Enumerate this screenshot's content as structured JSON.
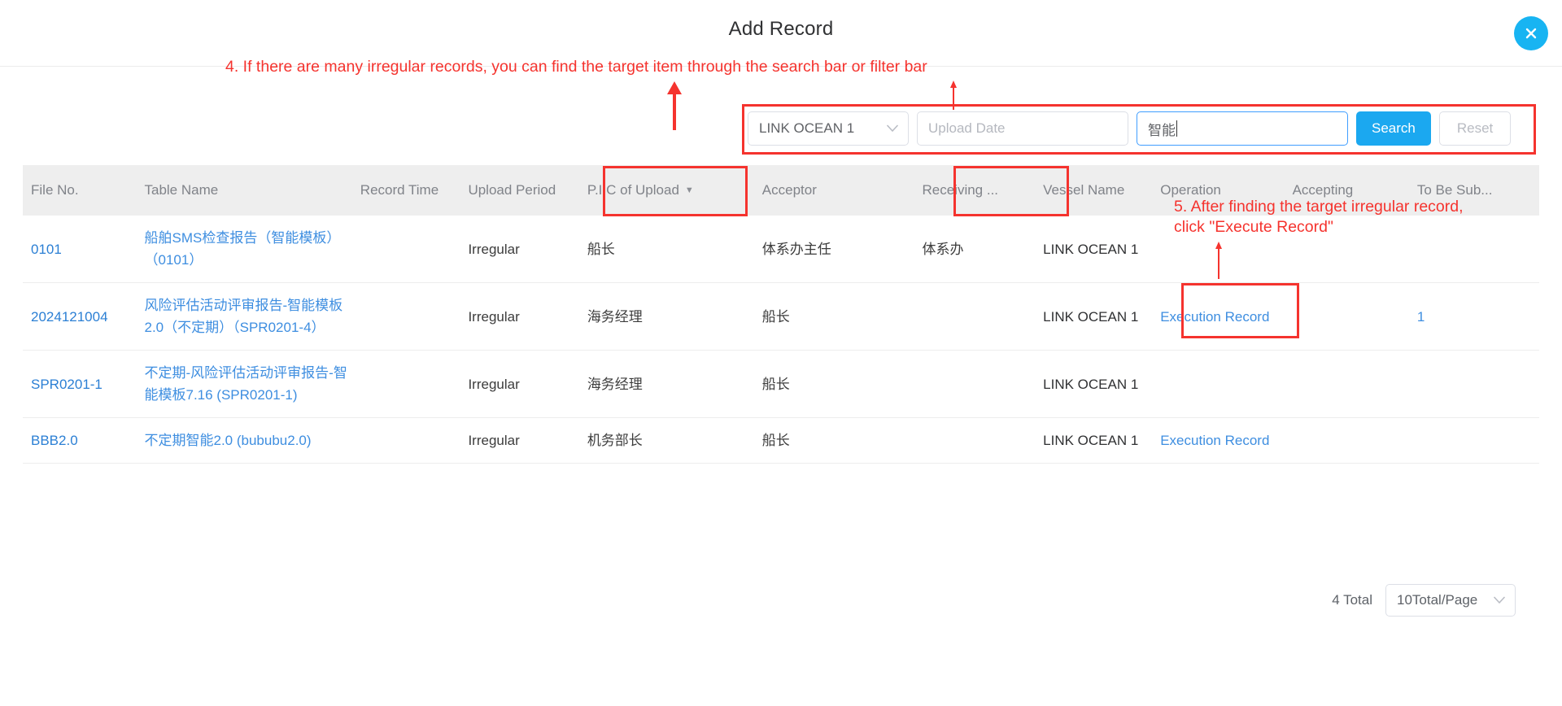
{
  "modal": {
    "title": "Add Record",
    "close_icon": "close-circle-icon"
  },
  "annotations": [
    {
      "id": "step4",
      "text": "4. If there are many irregular records, you can find the target item through the search bar or filter bar",
      "color": "#f5332e"
    },
    {
      "id": "step5",
      "line1": "5. After finding the target irregular record,",
      "line2": "click \"Execute Record\"",
      "color": "#f5332e"
    }
  ],
  "filter_bar": {
    "vessel_select": {
      "value": "LINK OCEAN 1",
      "caret_icon": "chevron-down-icon"
    },
    "upload_date": {
      "value": "",
      "placeholder": "Upload Date"
    },
    "keyword": {
      "value": "智能",
      "placeholder": ""
    },
    "search_label": "Search",
    "reset_label": "Reset"
  },
  "table": {
    "columns": [
      {
        "key": "file_no",
        "label": "File No."
      },
      {
        "key": "table_name",
        "label": "Table Name"
      },
      {
        "key": "record_time",
        "label": "Record Time"
      },
      {
        "key": "upload_period",
        "label": "Upload Period"
      },
      {
        "key": "pic_of_upload",
        "label": "P.I.C of Upload",
        "sortable": true,
        "sort_icon": "caret-down-icon"
      },
      {
        "key": "acceptor",
        "label": "Acceptor"
      },
      {
        "key": "receiving",
        "label": "Receiving ..."
      },
      {
        "key": "vessel_name",
        "label": "Vessel Name"
      },
      {
        "key": "operation",
        "label": "Operation"
      },
      {
        "key": "accepting",
        "label": "Accepting"
      },
      {
        "key": "to_be_sub",
        "label": "To Be Sub..."
      }
    ],
    "rows": [
      {
        "file_no": "0101",
        "table_name": "船舶SMS检查报告（智能模板）（0101）",
        "record_time": "",
        "upload_period": "Irregular",
        "pic_of_upload": "船长",
        "acceptor": "体系办主任",
        "receiving": "体系办",
        "vessel_name": "LINK OCEAN 1",
        "operation": "",
        "accepting": "",
        "to_be_sub": ""
      },
      {
        "file_no": "2024121004",
        "table_name": "风险评估活动评审报告-智能模板2.0（不定期）（SPR0201-4）",
        "record_time": "",
        "upload_period": "Irregular",
        "pic_of_upload": "海务经理",
        "acceptor": "船长",
        "receiving": "",
        "vessel_name": "LINK OCEAN 1",
        "operation": "Execution Record",
        "accepting": "",
        "to_be_sub": "1"
      },
      {
        "file_no": "SPR0201-1",
        "table_name": "不定期-风险评估活动评审报告-智能模板7.16 (SPR0201-1)",
        "record_time": "",
        "upload_period": "Irregular",
        "pic_of_upload": "海务经理",
        "acceptor": "船长",
        "receiving": "",
        "vessel_name": "LINK OCEAN 1",
        "operation": "",
        "accepting": "",
        "to_be_sub": ""
      },
      {
        "file_no": "BBB2.0",
        "table_name": "不定期智能2.0 (bububu2.0)",
        "record_time": "",
        "upload_period": "Irregular",
        "pic_of_upload": "机务部长",
        "acceptor": "船长",
        "receiving": "",
        "vessel_name": "LINK OCEAN 1",
        "operation": "Execution Record",
        "accepting": "",
        "to_be_sub": ""
      }
    ]
  },
  "pagination": {
    "total_label": "4 Total",
    "page_size": "10Total/Page",
    "caret_icon": "chevron-down-icon"
  },
  "colors": {
    "accent": "#1ba8f0",
    "link": "#3e8ee0",
    "annotation_red": "#f5332e",
    "header_bg": "#eeeeee"
  }
}
